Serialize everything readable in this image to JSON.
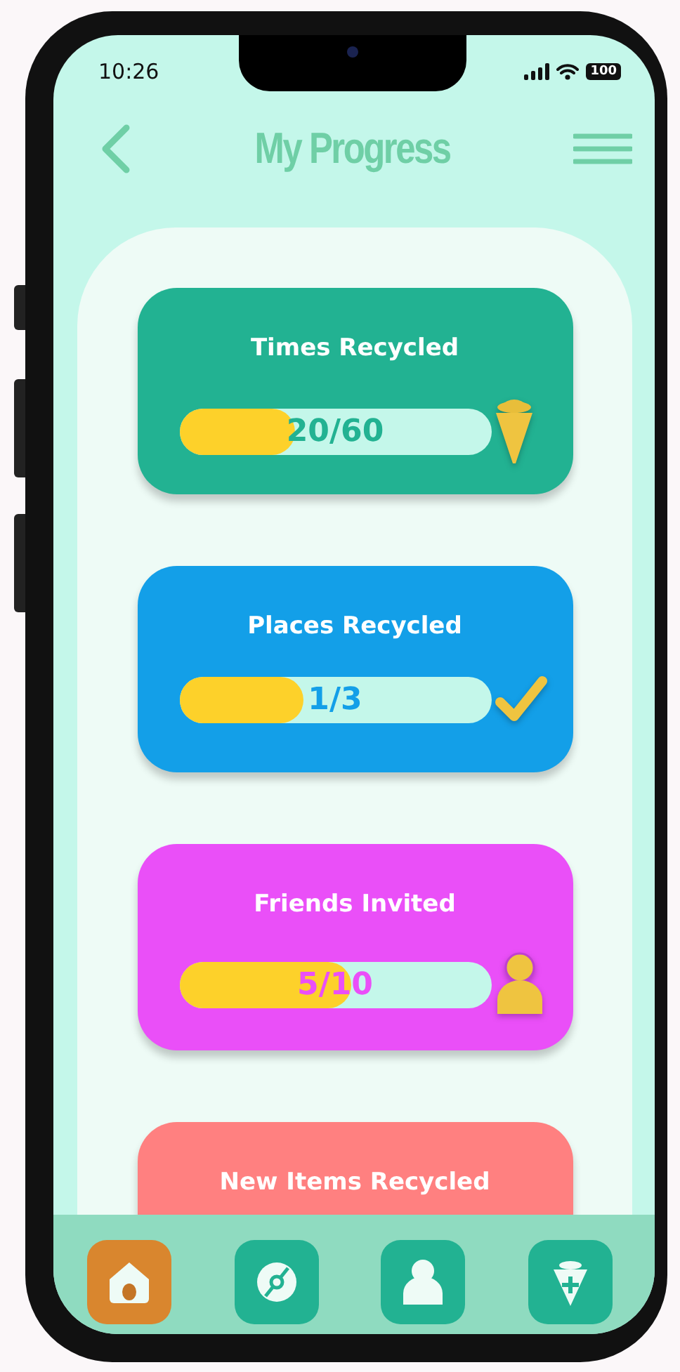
{
  "status_bar": {
    "time": "10:26",
    "battery": "100"
  },
  "header": {
    "title": "My Progress"
  },
  "cards": [
    {
      "title": "Times Recycled",
      "reading": "20/60",
      "level": 0.37,
      "color": "#22b292"
    },
    {
      "title": "Places Recycled",
      "reading": "1/3",
      "level": 0.4,
      "color": "#139fe8"
    },
    {
      "title": "Friends Invited",
      "reading": "5/10",
      "level": 0.55,
      "color": "#ea4ff8"
    },
    {
      "title": "New Items Recycled",
      "color": "#ff8080"
    }
  ],
  "tab_bar": [
    {
      "selected": true
    },
    {
      "selected": false
    },
    {
      "selected": false
    },
    {
      "selected": false
    }
  ]
}
